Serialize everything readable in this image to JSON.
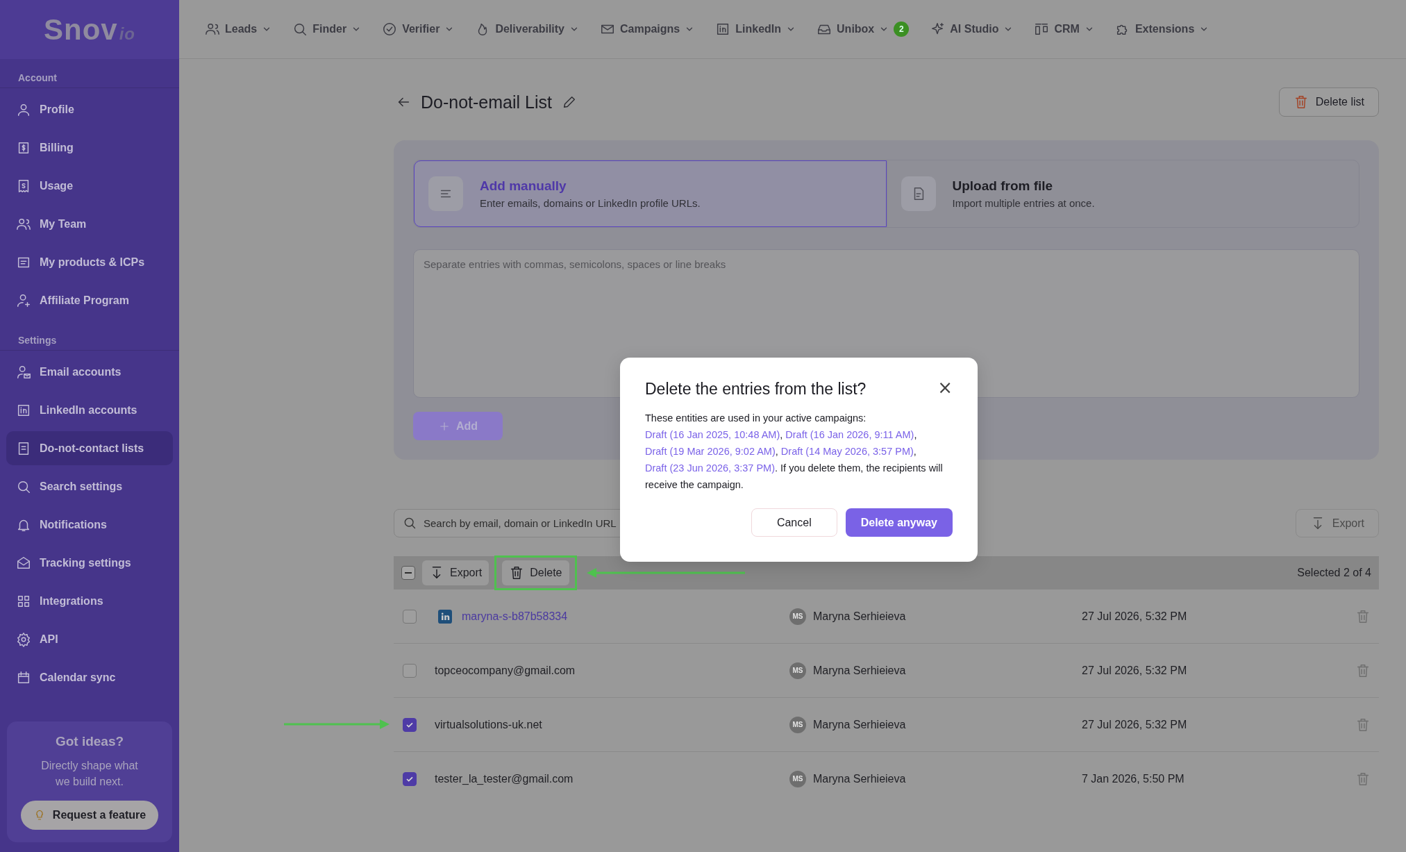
{
  "sidebar": {
    "logo": {
      "text": "Snov",
      "suffix": "io"
    },
    "sections": [
      {
        "title": "Account",
        "items": [
          {
            "label": "Profile",
            "selected": false
          },
          {
            "label": "Billing",
            "selected": false
          },
          {
            "label": "Usage",
            "selected": false
          },
          {
            "label": "My Team",
            "selected": false
          },
          {
            "label": "My products & ICPs",
            "selected": false
          },
          {
            "label": "Affiliate Program",
            "selected": false
          }
        ]
      },
      {
        "title": "Settings",
        "items": [
          {
            "label": "Email accounts",
            "selected": false
          },
          {
            "label": "LinkedIn accounts",
            "selected": false
          },
          {
            "label": "Do-not-contact lists",
            "selected": true
          },
          {
            "label": "Search settings",
            "selected": false
          },
          {
            "label": "Notifications",
            "selected": false
          },
          {
            "label": "Tracking settings",
            "selected": false
          },
          {
            "label": "Integrations",
            "selected": false
          },
          {
            "label": "API",
            "selected": false
          },
          {
            "label": "Calendar sync",
            "selected": false
          }
        ]
      }
    ],
    "promo": {
      "title": "Got ideas?",
      "text": "Directly shape what we build next.",
      "button": "Request a feature"
    }
  },
  "nav": [
    {
      "label": "Leads"
    },
    {
      "label": "Finder"
    },
    {
      "label": "Verifier"
    },
    {
      "label": "Deliverability"
    },
    {
      "label": "Campaigns"
    },
    {
      "label": "LinkedIn"
    },
    {
      "label": "Unibox",
      "badge": "2"
    },
    {
      "label": "AI Studio"
    },
    {
      "label": "CRM"
    },
    {
      "label": "Extensions"
    }
  ],
  "page": {
    "title": "Do-not-email List",
    "delete_list": "Delete list",
    "tabs": [
      {
        "title": "Add manually",
        "subtitle": "Enter emails, domains or LinkedIn profile URLs.",
        "selected": true
      },
      {
        "title": "Upload from file",
        "subtitle": "Import multiple entries at once.",
        "selected": false
      }
    ],
    "entries_field": {
      "placeholder": "Separate entries with commas, semicolons, spaces or line breaks"
    },
    "add_button": {
      "label": "Add",
      "disabled": true
    },
    "search": {
      "placeholder": "Search by email, domain or LinkedIn URL"
    },
    "export_button": {
      "label": "Export",
      "disabled": true
    }
  },
  "table": {
    "select_all": {
      "indeterminate": true
    },
    "bulk_export": "Export",
    "bulk_delete": "Delete",
    "selection": "Selected 2 of 4",
    "rows": [
      {
        "kind": "linkedin",
        "entry": "maryna-s-b87b58334",
        "initials": "MS",
        "owner": "Maryna Serhieieva",
        "date": "27 Jul 2026, 5:32 PM",
        "checked": false
      },
      {
        "kind": "text",
        "entry": "topceocompany@gmail.com",
        "initials": "MS",
        "owner": "Maryna Serhieieva",
        "date": "27 Jul 2026, 5:32 PM",
        "checked": false
      },
      {
        "kind": "text",
        "entry": "virtualsolutions-uk.net",
        "initials": "MS",
        "owner": "Maryna Serhieieva",
        "date": "27 Jul 2026, 5:32 PM",
        "checked": true
      },
      {
        "kind": "text",
        "entry": "tester_la_tester@gmail.com",
        "initials": "MS",
        "owner": "Maryna Serhieieva",
        "date": "7 Jan 2026, 5:50 PM",
        "checked": true
      }
    ]
  },
  "dialog": {
    "title": "Delete the entries from the list?",
    "close": "×",
    "message": [
      {
        "text": "These entities are used in your active campaigns: ",
        "link": false
      },
      {
        "text": "Draft (16 Jan 2025, 10:48 AM)",
        "link": true
      },
      {
        "text": ", ",
        "link": false
      },
      {
        "text": "Draft (16 Jan 2026, 9:11 AM)",
        "link": true
      },
      {
        "text": ", ",
        "link": false
      },
      {
        "text": "Draft (19 Mar 2026, 9:02 AM)",
        "link": true
      },
      {
        "text": ", ",
        "link": false
      },
      {
        "text": "Draft (14 May 2026, 3:57 PM)",
        "link": true
      },
      {
        "text": ", ",
        "link": false
      },
      {
        "text": "Draft (23 Jun 2026, 3:37 PM)",
        "link": true
      },
      {
        "text": ". If you delete them, the recipients will receive the campaign.",
        "link": false
      }
    ],
    "cancel": "Cancel",
    "confirm": "Delete anyway"
  }
}
